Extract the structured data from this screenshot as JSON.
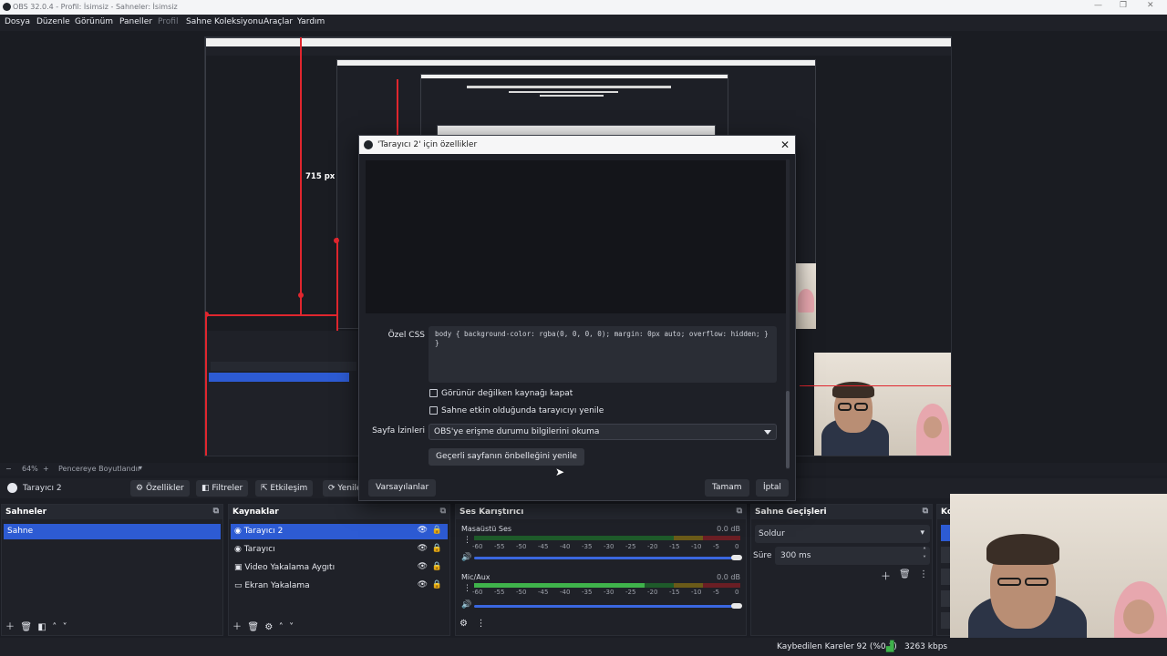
{
  "window": {
    "title": "OBS 32.0.4 - Profil: İsimsiz - Sahneler: İsimsiz"
  },
  "menu": [
    "Dosya",
    "Düzenle",
    "Görünüm",
    "Paneller",
    "Profil",
    "Sahne Koleksiyonu",
    "Araçlar",
    "Yardım"
  ],
  "preview": {
    "dimension_label": "715 px"
  },
  "zoom": {
    "level": "64%",
    "mode": "Pencereye Boyutlandır"
  },
  "source_toolbar": {
    "selected_source": "Tarayıcı 2",
    "properties": "Özellikler",
    "filters": "Filtreler",
    "interact": "Etkileşim",
    "refresh": "Yenile"
  },
  "dialog": {
    "title": "'Tarayıcı 2' için özellikler",
    "css_label": "Özel CSS",
    "css_value": "body { background-color: rgba(0, 0, 0, 0); margin: 0px auto; overflow: hidden; }\n}",
    "checkbox_shutdown": "Görünür değilken kaynağı kapat",
    "checkbox_refresh": "Sahne etkin olduğunda tarayıcıyı yenile",
    "permissions_label": "Sayfa İzinleri",
    "permissions_value": "OBS'ye erişme durumu bilgilerini okuma",
    "refresh_cache": "Geçerli sayfanın önbelleğini yenile",
    "defaults": "Varsayılanlar",
    "ok": "Tamam",
    "cancel": "İptal"
  },
  "scenes": {
    "header": "Sahneler",
    "items": [
      "Sahne"
    ]
  },
  "sources": {
    "header": "Kaynaklar",
    "items": [
      "Tarayıcı 2",
      "Tarayıcı",
      "Video Yakalama Aygıtı",
      "Ekran Yakalama"
    ]
  },
  "mixer": {
    "header": "Ses Karıştırıcı",
    "channels": [
      {
        "name": "Masaüstü Ses",
        "db": "0.0 dB",
        "level": 0
      },
      {
        "name": "Mic/Aux",
        "db": "0.0 dB",
        "level": 0.64
      }
    ],
    "scale": [
      "-60",
      "-55",
      "-50",
      "-45",
      "-40",
      "-35",
      "-30",
      "-25",
      "-20",
      "-15",
      "-10",
      "-5",
      "0"
    ]
  },
  "transitions": {
    "header": "Sahne Geçişleri",
    "type": "Soldur",
    "duration_label": "Süre",
    "duration": "300 ms"
  },
  "controls": {
    "header": "Ko"
  },
  "status": {
    "dropped_frames": "Kaybedilen Kareler 92 (%0.1)",
    "bitrate": "3263 kbps"
  },
  "colors": {
    "accent": "#2d5bd3",
    "selection_red": "#e0262e",
    "background": "#1b1d24"
  }
}
